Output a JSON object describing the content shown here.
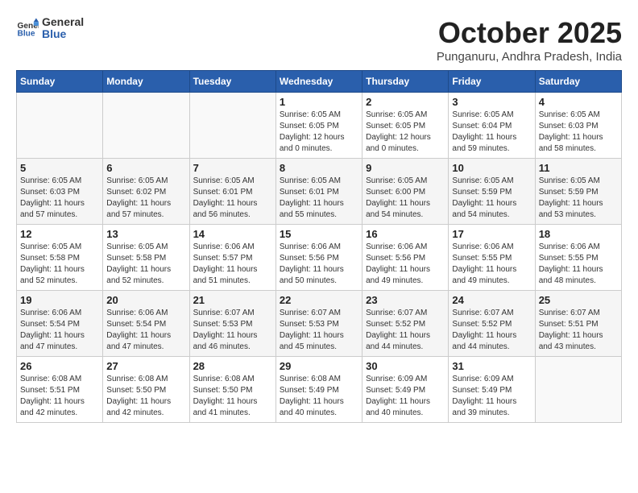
{
  "header": {
    "logo_line1": "General",
    "logo_line2": "Blue",
    "month": "October 2025",
    "location": "Punganuru, Andhra Pradesh, India"
  },
  "weekdays": [
    "Sunday",
    "Monday",
    "Tuesday",
    "Wednesday",
    "Thursday",
    "Friday",
    "Saturday"
  ],
  "weeks": [
    [
      {
        "day": "",
        "info": ""
      },
      {
        "day": "",
        "info": ""
      },
      {
        "day": "",
        "info": ""
      },
      {
        "day": "1",
        "info": "Sunrise: 6:05 AM\nSunset: 6:05 PM\nDaylight: 12 hours\nand 0 minutes."
      },
      {
        "day": "2",
        "info": "Sunrise: 6:05 AM\nSunset: 6:05 PM\nDaylight: 12 hours\nand 0 minutes."
      },
      {
        "day": "3",
        "info": "Sunrise: 6:05 AM\nSunset: 6:04 PM\nDaylight: 11 hours\nand 59 minutes."
      },
      {
        "day": "4",
        "info": "Sunrise: 6:05 AM\nSunset: 6:03 PM\nDaylight: 11 hours\nand 58 minutes."
      }
    ],
    [
      {
        "day": "5",
        "info": "Sunrise: 6:05 AM\nSunset: 6:03 PM\nDaylight: 11 hours\nand 57 minutes."
      },
      {
        "day": "6",
        "info": "Sunrise: 6:05 AM\nSunset: 6:02 PM\nDaylight: 11 hours\nand 57 minutes."
      },
      {
        "day": "7",
        "info": "Sunrise: 6:05 AM\nSunset: 6:01 PM\nDaylight: 11 hours\nand 56 minutes."
      },
      {
        "day": "8",
        "info": "Sunrise: 6:05 AM\nSunset: 6:01 PM\nDaylight: 11 hours\nand 55 minutes."
      },
      {
        "day": "9",
        "info": "Sunrise: 6:05 AM\nSunset: 6:00 PM\nDaylight: 11 hours\nand 54 minutes."
      },
      {
        "day": "10",
        "info": "Sunrise: 6:05 AM\nSunset: 5:59 PM\nDaylight: 11 hours\nand 54 minutes."
      },
      {
        "day": "11",
        "info": "Sunrise: 6:05 AM\nSunset: 5:59 PM\nDaylight: 11 hours\nand 53 minutes."
      }
    ],
    [
      {
        "day": "12",
        "info": "Sunrise: 6:05 AM\nSunset: 5:58 PM\nDaylight: 11 hours\nand 52 minutes."
      },
      {
        "day": "13",
        "info": "Sunrise: 6:05 AM\nSunset: 5:58 PM\nDaylight: 11 hours\nand 52 minutes."
      },
      {
        "day": "14",
        "info": "Sunrise: 6:06 AM\nSunset: 5:57 PM\nDaylight: 11 hours\nand 51 minutes."
      },
      {
        "day": "15",
        "info": "Sunrise: 6:06 AM\nSunset: 5:56 PM\nDaylight: 11 hours\nand 50 minutes."
      },
      {
        "day": "16",
        "info": "Sunrise: 6:06 AM\nSunset: 5:56 PM\nDaylight: 11 hours\nand 49 minutes."
      },
      {
        "day": "17",
        "info": "Sunrise: 6:06 AM\nSunset: 5:55 PM\nDaylight: 11 hours\nand 49 minutes."
      },
      {
        "day": "18",
        "info": "Sunrise: 6:06 AM\nSunset: 5:55 PM\nDaylight: 11 hours\nand 48 minutes."
      }
    ],
    [
      {
        "day": "19",
        "info": "Sunrise: 6:06 AM\nSunset: 5:54 PM\nDaylight: 11 hours\nand 47 minutes."
      },
      {
        "day": "20",
        "info": "Sunrise: 6:06 AM\nSunset: 5:54 PM\nDaylight: 11 hours\nand 47 minutes."
      },
      {
        "day": "21",
        "info": "Sunrise: 6:07 AM\nSunset: 5:53 PM\nDaylight: 11 hours\nand 46 minutes."
      },
      {
        "day": "22",
        "info": "Sunrise: 6:07 AM\nSunset: 5:53 PM\nDaylight: 11 hours\nand 45 minutes."
      },
      {
        "day": "23",
        "info": "Sunrise: 6:07 AM\nSunset: 5:52 PM\nDaylight: 11 hours\nand 44 minutes."
      },
      {
        "day": "24",
        "info": "Sunrise: 6:07 AM\nSunset: 5:52 PM\nDaylight: 11 hours\nand 44 minutes."
      },
      {
        "day": "25",
        "info": "Sunrise: 6:07 AM\nSunset: 5:51 PM\nDaylight: 11 hours\nand 43 minutes."
      }
    ],
    [
      {
        "day": "26",
        "info": "Sunrise: 6:08 AM\nSunset: 5:51 PM\nDaylight: 11 hours\nand 42 minutes."
      },
      {
        "day": "27",
        "info": "Sunrise: 6:08 AM\nSunset: 5:50 PM\nDaylight: 11 hours\nand 42 minutes."
      },
      {
        "day": "28",
        "info": "Sunrise: 6:08 AM\nSunset: 5:50 PM\nDaylight: 11 hours\nand 41 minutes."
      },
      {
        "day": "29",
        "info": "Sunrise: 6:08 AM\nSunset: 5:49 PM\nDaylight: 11 hours\nand 40 minutes."
      },
      {
        "day": "30",
        "info": "Sunrise: 6:09 AM\nSunset: 5:49 PM\nDaylight: 11 hours\nand 40 minutes."
      },
      {
        "day": "31",
        "info": "Sunrise: 6:09 AM\nSunset: 5:49 PM\nDaylight: 11 hours\nand 39 minutes."
      },
      {
        "day": "",
        "info": ""
      }
    ]
  ]
}
